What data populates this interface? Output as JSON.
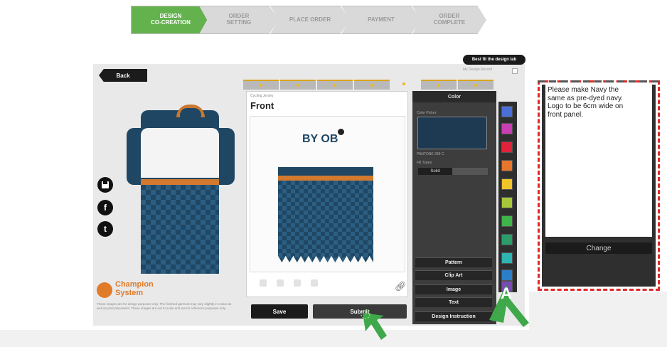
{
  "steps": [
    {
      "label": "DESIGN\nCO-CREATION",
      "active": true
    },
    {
      "label": "ORDER\nSETTING",
      "active": false
    },
    {
      "label": "PLACE ORDER",
      "active": false
    },
    {
      "label": "PAYMENT",
      "active": false
    },
    {
      "label": "ORDER\nCOMPLETE",
      "active": false
    }
  ],
  "nav": {
    "back_label": "Back"
  },
  "header": {
    "bestfit_label": "Best fit the design lab",
    "mydesign_label": "My Design Record"
  },
  "social": {
    "save_icon": "save-icon",
    "facebook_glyph": "f",
    "twitter_glyph": "t"
  },
  "brand": {
    "name": "Champion\nSystem",
    "note": "These images are for design purposes only. The finished garment may vary slightly in colour as well as print placement. These images are not to scale and are for reference purposes only."
  },
  "front": {
    "subtitle": "Cycling Jersey",
    "title": "Front",
    "logo_text": "BY\nOB"
  },
  "actions": {
    "save_label": "Save",
    "submit_label": "Submit"
  },
  "color_panel": {
    "title": "Color",
    "picker_label": "Color Picker:",
    "pantone": "PANTONE 289 C",
    "fill_label": "Fill Types:",
    "fill_solid": "Solid",
    "buttons": [
      "Pattern",
      "Clip Art",
      "Image",
      "Text",
      "Design Instruction"
    ]
  },
  "swatches": [
    "#4a6fd8",
    "#c83fb4",
    "#e0233a",
    "#e8762a",
    "#f1c52a",
    "#a8c83a",
    "#3fb449",
    "#2a9d6b",
    "#2fb4b4",
    "#2a7fc8",
    "#7a4ab4"
  ],
  "instruction": {
    "text": "Please make Navy the\nsame as pre-dyed navy.\nLogo to be 6cm wide on\nfront panel.",
    "change_label": "Change"
  },
  "callout": {
    "label": "A"
  },
  "colors": {
    "accent_green": "#63b24d",
    "brand_orange": "#e07b2a",
    "navy": "#1f4764",
    "highlight_red": "#e02828"
  }
}
